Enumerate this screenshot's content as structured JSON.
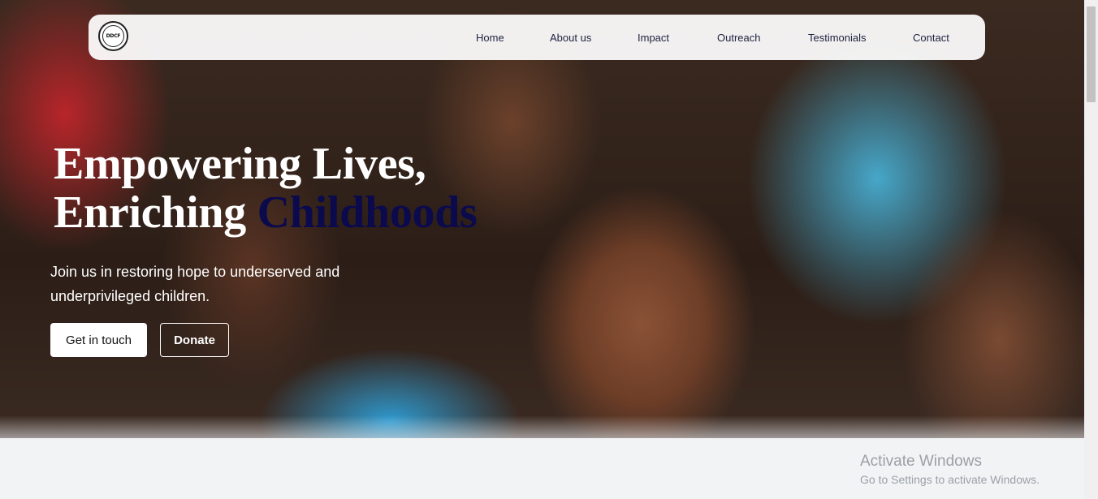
{
  "header": {
    "logo_text": "DDCF",
    "nav": [
      {
        "label": "Home"
      },
      {
        "label": "About us"
      },
      {
        "label": "Impact"
      },
      {
        "label": "Outreach"
      },
      {
        "label": "Testimonials"
      },
      {
        "label": "Contact"
      }
    ]
  },
  "hero": {
    "headline_line1": "Empowering Lives,",
    "headline_line2_prefix": "Enriching ",
    "headline_accent": "Childhoods",
    "subtitle": "Join us in restoring hope to underserved and underprivileged children.",
    "primary_button": "Get in touch",
    "secondary_button": "Donate"
  },
  "watermark": {
    "title": "Activate Windows",
    "subtitle": "Go to Settings to activate Windows."
  },
  "colors": {
    "accent": "#0b0a4d",
    "nav_text": "#1e2240",
    "page_background": "#f2f3f5"
  }
}
